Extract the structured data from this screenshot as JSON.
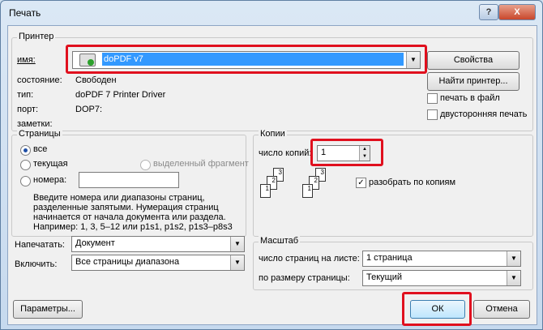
{
  "window": {
    "title": "Печать",
    "help_label": "?",
    "close_label": "X"
  },
  "printer": {
    "group_label": "Принтер",
    "name_label": "имя:",
    "name_value": "doPDF v7",
    "status_label": "состояние:",
    "status_value": "Свободен",
    "type_label": "тип:",
    "type_value": "doPDF 7 Printer Driver",
    "port_label": "порт:",
    "port_value": "DOP7:",
    "notes_label": "заметки:",
    "notes_value": "",
    "properties_button": "Свойства",
    "find_button": "Найти принтер...",
    "print_to_file": "печать в файл",
    "duplex": "двусторонняя печать"
  },
  "pages": {
    "group_label": "Страницы",
    "all": "все",
    "current": "текущая",
    "selection": "выделенный фрагмент",
    "numbers": "номера:",
    "numbers_value": "",
    "hint": [
      "Введите номера или диапазоны страниц,",
      "разделенные запятыми. Нумерация страниц",
      "начинается от начала документа или раздела.",
      "Например: 1, 3, 5–12 или p1s1, p1s2, p1s3–p8s3"
    ]
  },
  "copies": {
    "group_label": "Копии",
    "count_label": "число копий:",
    "count_value": "1",
    "collate_label": "разобрать по копиям",
    "collate_checked": true
  },
  "print_what": {
    "label": "Напечатать:",
    "value": "Документ"
  },
  "include": {
    "label": "Включить:",
    "value": "Все страницы диапазона"
  },
  "zoom": {
    "group_label": "Масштаб",
    "pages_per_sheet_label": "число страниц на листе:",
    "pages_per_sheet_value": "1 страница",
    "scale_label": "по размеру страницы:",
    "scale_value": "Текущий"
  },
  "buttons": {
    "options": "Параметры...",
    "ok": "ОК",
    "cancel": "Отмена"
  },
  "colors": {
    "highlight": "#e0101e",
    "selection": "#3399ff"
  }
}
